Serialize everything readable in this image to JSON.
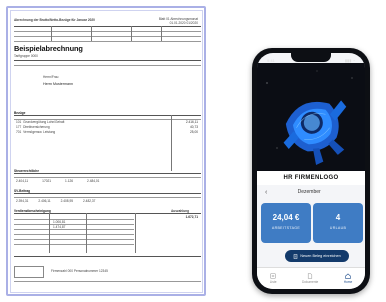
{
  "document": {
    "firm_line": "Abrechnung der Brutto/Netto-Bezüge für Januar 2020",
    "header_meta": [
      "Blatt 01   Abrechnungsmonat",
      "01.01.2020   01/2020"
    ],
    "title": "Beispielabrechnung",
    "title_sub": "Tarifgruppe 0000",
    "employee_label": "Herrn/Frau",
    "employee_name": "Herrn Mustermann",
    "section_earnings": "Bezüge",
    "earnings_rows": [
      {
        "code": "101",
        "text": "Grundvergütung Lohn/Gehalt",
        "amount": "2.416,11"
      },
      {
        "code": "177",
        "text": "Direktversicherung",
        "amount": "40,73"
      },
      {
        "code": "701",
        "text": "Vermögensw. Leistung",
        "amount": "25,00"
      }
    ],
    "section_taxes": "Steuerrechtliche",
    "tax_values": [
      "2.404,11",
      "17021",
      "1.126",
      "2.484,01"
    ],
    "section_social": "SV-Beitrag",
    "social_values": [
      "2.394,31",
      "2.406,11",
      "2.408,95",
      "2.482,37"
    ],
    "section_net": "Verdienstbescheinigung",
    "net_values": [
      "1.006,81",
      "1.474,87"
    ],
    "net_label": "Auszahlung",
    "net_amount": "1.672,71",
    "footer": "Firmenzahl 000   Personalnummer 12345"
  },
  "phone": {
    "status_time": "9:41",
    "status_icons": "▮▮▮ ◔",
    "company": "HR FIRMENLOGO",
    "month": "Dezember",
    "month_chevron": "‹",
    "tiles": [
      {
        "value": "24,04 €",
        "label": "ARBEITSTAGE"
      },
      {
        "value": "4",
        "label": "URLAUB"
      }
    ],
    "cta_label": "Neuen Beleg einreichen",
    "tabs": [
      {
        "label": "Liste",
        "icon": "list-icon"
      },
      {
        "label": "Dokumente",
        "icon": "document-icon"
      },
      {
        "label": "Home",
        "icon": "home-icon"
      }
    ],
    "accent": "#3f7cc4",
    "dark_accent": "#133a6b"
  }
}
